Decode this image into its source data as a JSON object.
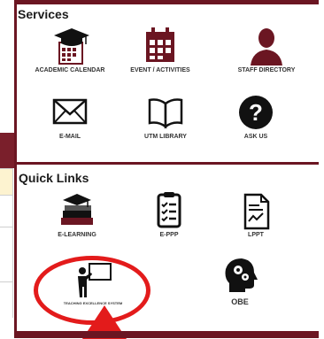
{
  "services": {
    "title": "Services",
    "items": [
      {
        "label": "ACADEMIC CALENDAR",
        "icon": "graduation-calendar-icon"
      },
      {
        "label": "EVENT / ACTIVITIES",
        "icon": "calendar-icon"
      },
      {
        "label": "STAFF DIRECTORY",
        "icon": "person-icon"
      },
      {
        "label": "E-MAIL",
        "icon": "envelope-icon"
      },
      {
        "label": "UTM LIBRARY",
        "icon": "book-icon"
      },
      {
        "label": "ASK US",
        "icon": "question-icon"
      }
    ]
  },
  "quick_links": {
    "title": "Quick Links",
    "items": [
      {
        "label": "E-LEARNING",
        "icon": "books-stack-icon"
      },
      {
        "label": "E-PPP",
        "icon": "checklist-icon"
      },
      {
        "label": "LPPT",
        "icon": "report-document-icon"
      },
      {
        "label": "TEACHING EXCELLENCE SYSTEM",
        "icon": "teacher-board-icon"
      },
      {
        "label": "OBE",
        "icon": "head-gears-icon"
      }
    ]
  },
  "colors": {
    "brand": "#6b1622",
    "highlight": "#e31b1b"
  }
}
